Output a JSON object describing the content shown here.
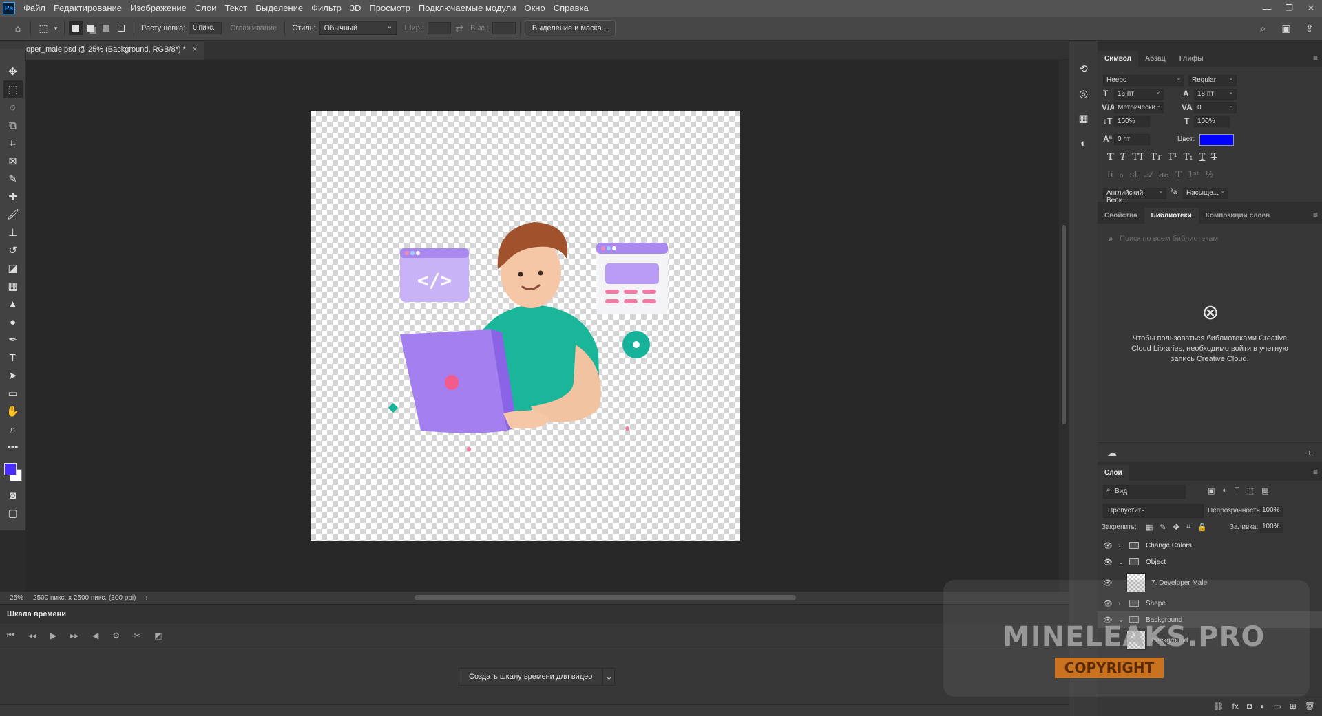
{
  "app": {
    "logo_text": "Ps"
  },
  "menu": [
    "Файл",
    "Редактирование",
    "Изображение",
    "Слои",
    "Текст",
    "Выделение",
    "Фильтр",
    "3D",
    "Просмотр",
    "Подключаемые модули",
    "Окно",
    "Справка"
  ],
  "options": {
    "feather_label": "Растушевка:",
    "feather_value": "0 пикс.",
    "antialias_label": "Сглаживание",
    "style_label": "Стиль:",
    "style_value": "Обычный",
    "width_label": "Шир.:",
    "height_label": "Выс.:",
    "mask_button": "Выделение и маска..."
  },
  "document": {
    "tab_title": "oper_male.psd @ 25% (Background, RGB/8*) *",
    "close_glyph": "×"
  },
  "colors": {
    "foreground": "#4a2cff",
    "background": "#ffffff",
    "text_color": "#0000ff"
  },
  "status": {
    "zoom": "25%",
    "dimensions": "2500 пикс. x 2500 пикс. (300 ppi)",
    "arrow": "›"
  },
  "timeline": {
    "title": "Шкала времени",
    "create_button": "Создать шкалу времени для видео"
  },
  "character": {
    "tabs": [
      "Символ",
      "Абзац",
      "Глифы"
    ],
    "font_family": "Heebo",
    "font_style": "Regular",
    "font_size": "16 пт",
    "leading": "18 пт",
    "kerning": "Метрически",
    "tracking": "0",
    "vertical_scale": "100%",
    "horizontal_scale": "100%",
    "baseline_shift": "0 пт",
    "color_label": "Цвет:",
    "language": "Английский: Вели...",
    "antialias": "Насыще...",
    "aa_glyph": "ªa"
  },
  "libraries": {
    "tabs": [
      "Свойства",
      "Библиотеки",
      "Композиции слоев"
    ],
    "search_placeholder": "Поиск по всем библиотекам",
    "message": "Чтобы пользоваться библиотеками Creative Cloud Libraries, необходимо войти в учетную запись Creative Cloud."
  },
  "layers": {
    "tab": "Слои",
    "filter_label": "Вид",
    "blend_mode": "Пропустить",
    "opacity_label": "Непрозрачность:",
    "opacity_value": "100%",
    "lock_label": "Закрепить:",
    "fill_label": "Заливка:",
    "fill_value": "100%",
    "items": [
      {
        "name": "Change Colors",
        "type": "group"
      },
      {
        "name": "Object",
        "type": "group"
      },
      {
        "name": "7. Developer Male",
        "type": "layer"
      },
      {
        "name": "Shape",
        "type": "group"
      },
      {
        "name": "Background",
        "type": "group"
      },
      {
        "name": "Background",
        "type": "layer"
      }
    ]
  },
  "watermark": {
    "text": "MINELEAKS.PRO",
    "sub": "COPYRIGHT"
  }
}
